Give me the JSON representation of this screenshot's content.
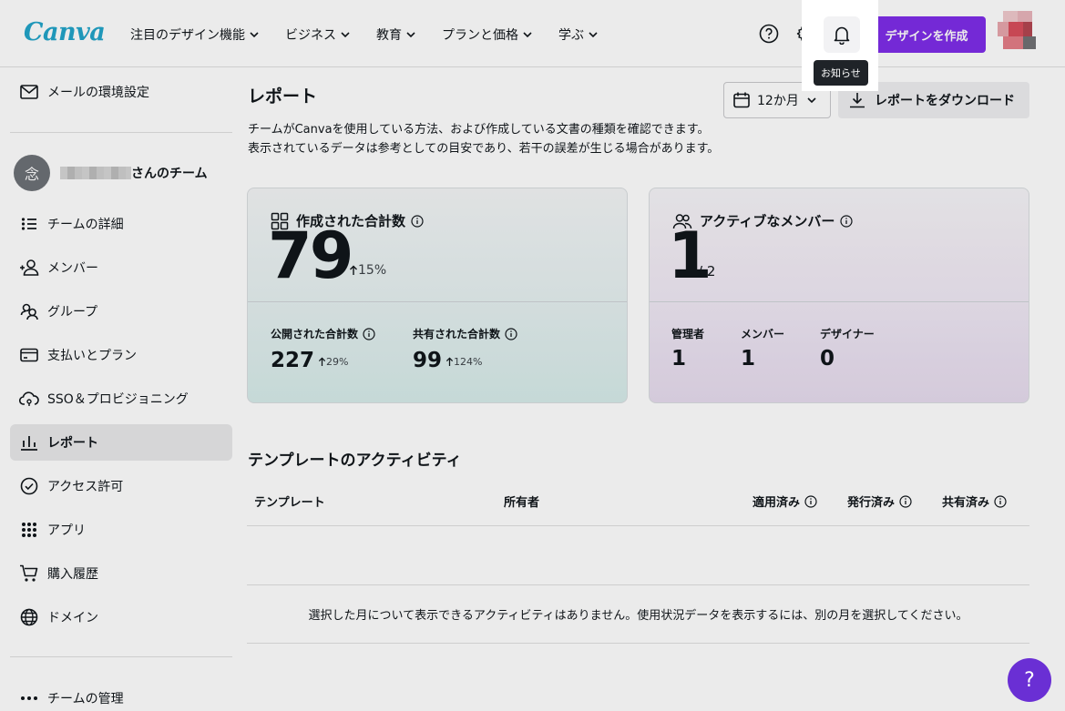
{
  "header": {
    "logo": "Canva",
    "nav": [
      "注目のデザイン機能",
      "ビジネス",
      "教育",
      "プランと価格",
      "学ぶ"
    ],
    "notification_tooltip": "お知らせ",
    "create_label": "デザインを作成"
  },
  "sidebar": {
    "email_settings": "メールの環境設定",
    "team_avatar_char": "念",
    "team_suffix": "さんのチーム",
    "items": [
      "チームの詳細",
      "メンバー",
      "グループ",
      "支払いとプラン",
      "SSO＆プロビジョニング",
      "レポート",
      "アクセス許可",
      "アプリ",
      "購入履歴",
      "ドメイン"
    ],
    "active_item": "レポート",
    "manage_team": "チームの管理"
  },
  "main": {
    "title": "レポート",
    "period": "12か月",
    "download_label": "レポートをダウンロード",
    "description": [
      "チームがCanvaを使用している方法、および作成している文書の種類を確認できます。",
      "表示されているデータは参考としての目安であり、若干の誤差が生じる場合があります。"
    ],
    "created_card": {
      "title": "作成された合計数",
      "value": "79",
      "change": "15%",
      "published_label": "公開された合計数",
      "published_value": "227",
      "published_change": "29%",
      "shared_label": "共有された合計数",
      "shared_value": "99",
      "shared_change": "124%"
    },
    "members_card": {
      "title": "アクティブなメンバー",
      "value": "1",
      "total": "/ 2",
      "roles": [
        {
          "label": "管理者",
          "value": "1"
        },
        {
          "label": "メンバー",
          "value": "1"
        },
        {
          "label": "デザイナー",
          "value": "0"
        }
      ]
    },
    "template_section": {
      "title": "テンプレートのアクティビティ",
      "columns": [
        "テンプレート",
        "所有者",
        "適用済み",
        "発行済み",
        "共有済み"
      ],
      "empty_message": "選択した月について表示できるアクティビティはありません。使用状況データを表示するには、別の月を選択してください。"
    }
  },
  "help_fab": "?",
  "colors": {
    "brand_purple": "#7d2ae8",
    "logo_blue": "#1fa3c9"
  }
}
